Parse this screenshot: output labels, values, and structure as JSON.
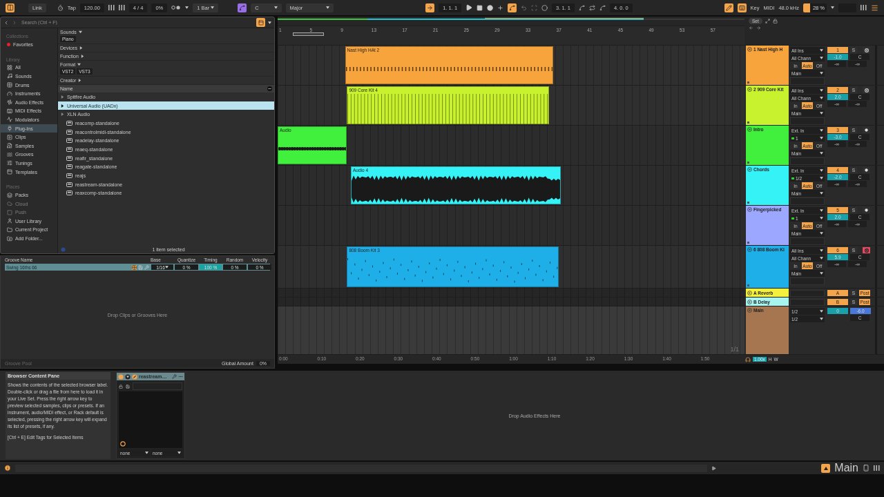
{
  "top_bar": {
    "view_toggle": {
      "on": true
    },
    "link": "Link",
    "tap": "Tap",
    "tempo": "120.00",
    "time_signature": "4 / 4",
    "percent_field": "0%",
    "quantization": "1 Bar",
    "scale_mode": {
      "on": true
    },
    "key": "C",
    "scale": "Major",
    "follow": {
      "on": true
    },
    "position": "1. 1. 1",
    "automation_arm": {
      "on": true
    },
    "loop_start": "3. 1. 1",
    "loop_length": "4. 0. 0",
    "draw_mode": {
      "on": true
    },
    "computer_keyboard": {
      "on": true
    },
    "key_map": "Key",
    "midi_map": "MIDI",
    "sample_rate": "48.0 kHz",
    "cpu": {
      "reading": "28 %",
      "level": 0.28
    }
  },
  "browser": {
    "search": {
      "placeholder": "Search (Ctrl + F)"
    },
    "sidebar": [
      {
        "title": "Collections",
        "items": [
          {
            "label": "Favorites",
            "color": "#e8202a"
          }
        ]
      },
      {
        "title": "Library",
        "items": [
          {
            "label": "All",
            "selected": false
          },
          {
            "label": "Sounds",
            "selected": false
          },
          {
            "label": "Drums",
            "selected": false
          },
          {
            "label": "Instruments",
            "selected": false
          },
          {
            "label": "Audio Effects",
            "selected": false
          },
          {
            "label": "MIDI Effects",
            "selected": false
          },
          {
            "label": "Modulators",
            "selected": false
          },
          {
            "label": "Plug-Ins",
            "selected": true
          },
          {
            "label": "Clips",
            "selected": false
          },
          {
            "label": "Samples",
            "selected": false
          },
          {
            "label": "Grooves",
            "selected": false
          },
          {
            "label": "Tunings",
            "selected": false
          },
          {
            "label": "Templates",
            "selected": false
          }
        ]
      },
      {
        "title": "Places",
        "items": [
          {
            "label": "Packs",
            "disabled": false
          },
          {
            "label": "Cloud",
            "disabled": true
          },
          {
            "label": "Push",
            "disabled": true
          },
          {
            "label": "User Library",
            "disabled": false
          },
          {
            "label": "Current Project",
            "disabled": false
          },
          {
            "label": "Add Folder...",
            "disabled": false
          }
        ]
      }
    ],
    "filters": [
      {
        "label": "Sounds",
        "expanded": true,
        "tags": [
          "Piano"
        ]
      },
      {
        "label": "Devices",
        "expanded": false
      },
      {
        "label": "Function",
        "expanded": false
      },
      {
        "label": "Format",
        "expanded": true,
        "tags": [
          "VST2",
          "VST3"
        ]
      },
      {
        "label": "Creator",
        "expanded": false
      }
    ],
    "column": "Name",
    "files": [
      {
        "label": "Spitfire Audio",
        "kind": "folder",
        "selected": false
      },
      {
        "label": "Universal Audio (UADx)",
        "kind": "folder",
        "selected": true
      },
      {
        "label": "XLN Audio",
        "kind": "folder",
        "selected": false
      },
      {
        "label": "reacomp-standalone",
        "kind": "plugin",
        "selected": false
      },
      {
        "label": "reacontrolmidi-standalone",
        "kind": "plugin",
        "selected": false
      },
      {
        "label": "readelay-standalone",
        "kind": "plugin",
        "selected": false
      },
      {
        "label": "reaeq-standalone",
        "kind": "plugin",
        "selected": false
      },
      {
        "label": "reafir_standalone",
        "kind": "plugin",
        "selected": false
      },
      {
        "label": "reagate-standalone",
        "kind": "plugin",
        "selected": false
      },
      {
        "label": "reajs",
        "kind": "plugin",
        "selected": false
      },
      {
        "label": "reastream-standalone",
        "kind": "plugin",
        "selected": false
      },
      {
        "label": "reaxcomp-standalone",
        "kind": "plugin",
        "selected": false
      }
    ],
    "status": "1 item selected"
  },
  "groove_pool": {
    "columns": [
      "Groove Name",
      "Base",
      "Quantize",
      "Timing",
      "Random",
      "Velocity"
    ],
    "rows": [
      {
        "name": "Swing 16ths 66",
        "base": "1/16",
        "quantize": "0 %",
        "timing": "100 %",
        "random": "0 %",
        "velocity": "0 %",
        "selected": true
      }
    ],
    "hint": "Drop Clips or Grooves Here",
    "title": "Groove Pool",
    "global_amount_label": "Global Amount",
    "global_amount": "0%"
  },
  "arrangement": {
    "bar_labels": [
      "1",
      "5",
      "9",
      "13",
      "17",
      "21",
      "25",
      "29",
      "33",
      "37",
      "41",
      "45",
      "49",
      "53",
      "57"
    ],
    "time_labels": [
      "0:00",
      "0:10",
      "0:20",
      "0:30",
      "0:40",
      "0:50",
      "1:00",
      "1:10",
      "1:20",
      "1:30",
      "1:40",
      "1:50"
    ],
    "page": "1/1",
    "set_button": "Set",
    "zoom": "1.00x",
    "h": "H",
    "w": "W",
    "tracks": [
      {
        "name": "1 Nast High H",
        "color": "#f8a43c",
        "kind": "midi",
        "input": "All Ins",
        "channel": "All Chann",
        "monitor": [
          {
            "label": "In",
            "selected": false
          },
          {
            "label": "Auto",
            "selected": true
          },
          {
            "label": "Off",
            "selected": false
          }
        ],
        "output": "Main",
        "number": "1",
        "solo": "S",
        "armed": false,
        "volume": "-1.0",
        "pan": "C",
        "sends": [
          "-∞",
          "-∞"
        ],
        "clips": [
          {
            "name": "Nast High HAt 2"
          }
        ]
      },
      {
        "name": "2 909 Core Kit",
        "color": "#c9f22e",
        "kind": "midi",
        "input": "All Ins",
        "channel": "All Chann",
        "monitor": [
          {
            "label": "In",
            "selected": false
          },
          {
            "label": "Auto",
            "selected": true
          },
          {
            "label": "Off",
            "selected": false
          }
        ],
        "output": "Main",
        "number": "2",
        "solo": "S",
        "armed": false,
        "volume": "2.0",
        "pan": "C",
        "sends": [
          "-∞",
          "-∞"
        ],
        "clips": [
          {
            "name": "909 Core Kit 4"
          }
        ]
      },
      {
        "name": "Intro",
        "color": "#40f03c",
        "kind": "audio",
        "input": "Ext. In",
        "channel": "1",
        "monitor": [
          {
            "label": "In",
            "selected": false
          },
          {
            "label": "Auto",
            "selected": true
          },
          {
            "label": "Off",
            "selected": false
          }
        ],
        "output": "Main",
        "number": "3",
        "solo": "S",
        "armed": false,
        "volume": "-3.0",
        "pan": "C",
        "sends": [
          "-∞",
          "-∞"
        ],
        "clips": [
          {
            "name": "Audio"
          }
        ]
      },
      {
        "name": "Chords",
        "color": "#34f2f6",
        "kind": "audio",
        "input": "Ext. In",
        "channel": "1/2",
        "monitor": [
          {
            "label": "In",
            "selected": false
          },
          {
            "label": "Auto",
            "selected": true
          },
          {
            "label": "Off",
            "selected": false
          }
        ],
        "output": "Main",
        "number": "4",
        "solo": "S",
        "armed": false,
        "volume": "-2.0",
        "pan": "C",
        "sends": [
          "-∞",
          "-∞"
        ],
        "clips": [
          {
            "name": "Audio 4"
          }
        ]
      },
      {
        "name": "Fingerpicked",
        "color": "#9ca8ff",
        "kind": "audio",
        "input": "Ext. In",
        "channel": "1",
        "monitor": [
          {
            "label": "In",
            "selected": false
          },
          {
            "label": "Auto",
            "selected": true
          },
          {
            "label": "Off",
            "selected": false
          }
        ],
        "output": "Main",
        "number": "5",
        "solo": "S",
        "armed": false,
        "volume": "2.0",
        "pan": "C",
        "sends": [
          "-∞",
          "-∞"
        ]
      },
      {
        "name": "6 808 Boom Ki",
        "color": "#1fafe8",
        "kind": "midi",
        "input": "All Ins",
        "channel": "All Chann",
        "monitor": [
          {
            "label": "In",
            "selected": false
          },
          {
            "label": "Auto",
            "selected": true
          },
          {
            "label": "Off",
            "selected": false
          }
        ],
        "output": "Main",
        "number": "6",
        "solo": "S",
        "armed": true,
        "volume": "5.9",
        "pan": "C",
        "sends": [
          "-∞",
          "-∞"
        ],
        "clips": [
          {
            "name": "808 Boom Kit 3"
          }
        ]
      }
    ],
    "returns": [
      {
        "name": "A Reverb",
        "color": "#f4f03e",
        "letter": "A",
        "solo": "S",
        "post": "Post"
      },
      {
        "name": "B Delay",
        "color": "#a6f5ef",
        "letter": "B",
        "solo": "S",
        "post": "Post"
      }
    ],
    "main": {
      "name": "Main",
      "color": "#a67650",
      "cue_out": "1/2",
      "main_out": "1/2",
      "cue_volume": "0",
      "volume": "-6.0",
      "pan": "C"
    }
  },
  "device_area": {
    "info": {
      "title": "Browser Content Pane",
      "body": "Shows the contents of the selected browser label. Double-click or drag a file from here to load it in your Live Set. Press the right arrow key to preview selected samples, clips or presets. If an instrument, audio/MIDI effect, or Rack default is selected, pressing the right arrow key will expand its list of presets, if any.",
      "shortcut": "[Ctrl + E] Edit Tags for Selected Items"
    },
    "device": {
      "name": "reastream…",
      "on": true,
      "inputs": [
        "none",
        "none"
      ]
    },
    "drop_hint": "Drop Audio Effects Here"
  },
  "status_bar": {
    "output": "Main"
  }
}
